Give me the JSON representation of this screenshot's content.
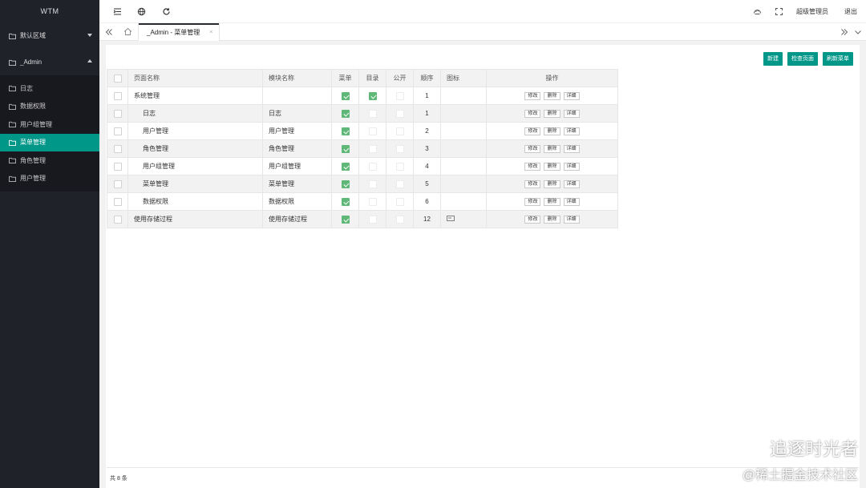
{
  "app": {
    "title": "WTM"
  },
  "sidebar": {
    "groups": [
      {
        "label": "默认区域",
        "expanded": false
      },
      {
        "label": "_Admin",
        "expanded": true
      }
    ],
    "items": [
      {
        "label": "日志",
        "active": false
      },
      {
        "label": "数据权限",
        "active": false
      },
      {
        "label": "用户组管理",
        "active": false
      },
      {
        "label": "菜单管理",
        "active": true
      },
      {
        "label": "角色管理",
        "active": false
      },
      {
        "label": "用户管理",
        "active": false
      }
    ]
  },
  "header": {
    "user": "超级管理员",
    "logout": "退出",
    "icons": [
      "menu-fold-icon",
      "globe-icon",
      "refresh-icon",
      "theme-icon",
      "fullscreen-icon"
    ]
  },
  "tabs": {
    "active_label": "_Admin - 菜单管理",
    "close": "×"
  },
  "toolbar": {
    "new_label": "新建",
    "check_label": "检查页面",
    "refresh_label": "刷新菜单"
  },
  "table": {
    "headers": [
      "页面名称",
      "模块名称",
      "菜单",
      "目录",
      "公开",
      "顺序",
      "图标",
      "操作"
    ],
    "rows": [
      {
        "page": "系统管理",
        "module": "",
        "menu": true,
        "folder": true,
        "public": false,
        "order": "1",
        "icon": ""
      },
      {
        "page": "日志",
        "module": "日志",
        "menu": true,
        "folder": false,
        "public": false,
        "order": "1",
        "icon": ""
      },
      {
        "page": "用户管理",
        "module": "用户管理",
        "menu": true,
        "folder": false,
        "public": false,
        "order": "2",
        "icon": ""
      },
      {
        "page": "角色管理",
        "module": "角色管理",
        "menu": true,
        "folder": false,
        "public": false,
        "order": "3",
        "icon": ""
      },
      {
        "page": "用户组管理",
        "module": "用户组管理",
        "menu": true,
        "folder": false,
        "public": false,
        "order": "4",
        "icon": ""
      },
      {
        "page": "菜单管理",
        "module": "菜单管理",
        "menu": true,
        "folder": false,
        "public": false,
        "order": "5",
        "icon": ""
      },
      {
        "page": "数据权限",
        "module": "数据权限",
        "menu": true,
        "folder": false,
        "public": false,
        "order": "6",
        "icon": ""
      },
      {
        "page": "使用存储过程",
        "module": "使用存储过程",
        "menu": true,
        "folder": false,
        "public": false,
        "order": "12",
        "icon": "card-icon"
      }
    ],
    "actions": {
      "edit": "修改",
      "delete": "删除",
      "detail": "详细"
    },
    "footer": "共 8 条"
  },
  "watermark": {
    "line1": "追逐时光者",
    "line2": "@稀土掘金技术社区"
  },
  "colors": {
    "sidebar_bg": "#20222a",
    "accent": "#009688",
    "check": "#5fb878"
  }
}
